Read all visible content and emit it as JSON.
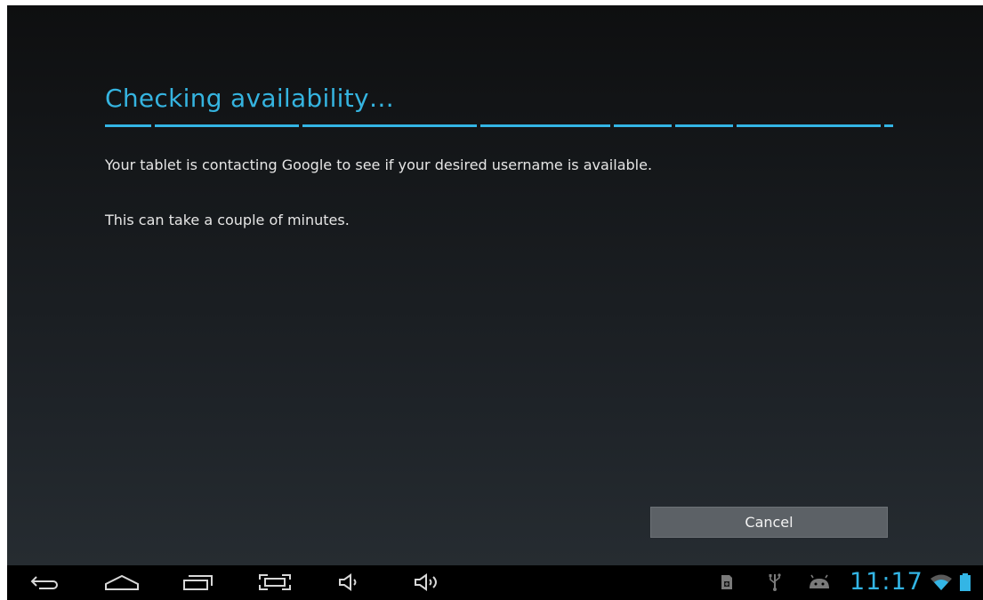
{
  "dialog": {
    "title": "Checking availability…",
    "message": "Your tablet is contacting Google to see if your desired username is available.",
    "submessage": "This can take a couple of minutes.",
    "cancel_label": "Cancel",
    "accent_color": "#33b5e5"
  },
  "navbar": {
    "buttons": [
      "back-icon",
      "home-icon",
      "recent-apps-icon",
      "screenshot-icon",
      "volume-down-icon",
      "volume-up-icon"
    ]
  },
  "statusbar": {
    "icons": [
      "sd-card-icon",
      "usb-icon",
      "android-debug-icon",
      "wifi-icon",
      "battery-icon"
    ],
    "time": "11:17"
  }
}
